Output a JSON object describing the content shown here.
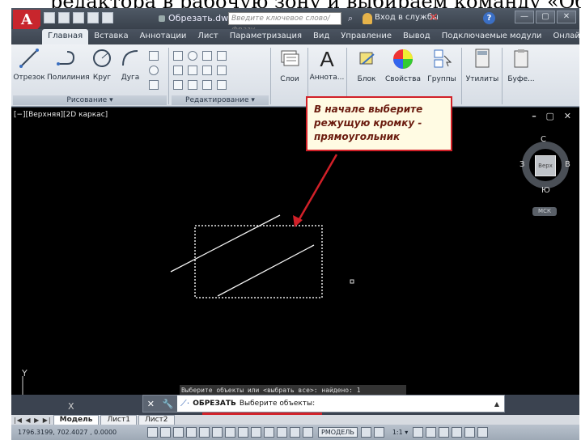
{
  "page_caption": "редактора в рабочую зону и выбираем команду «Обрезать» в группе",
  "title_bar": {
    "file_name": "Обрезать.dwg",
    "search_placeholder": "Введите ключевое слово/фразу",
    "signin": "Вход в службы",
    "window_buttons": [
      "—",
      "▢",
      "✕"
    ]
  },
  "ribbon_tabs": [
    "Главная",
    "Вставка",
    "Аннотации",
    "Лист",
    "Параметризация",
    "Вид",
    "Управление",
    "Вывод",
    "Подключаемые модули",
    "Онлайн",
    "»"
  ],
  "ribbon": {
    "draw": {
      "line": "Отрезок",
      "polyline": "Полилиния",
      "circle": "Круг",
      "arc": "Дуга",
      "group_label": "Рисование ▾"
    },
    "modify": {
      "group_label": "Редактирование ▾"
    },
    "layers": "Слои",
    "annotation": "Аннота...",
    "annotation_letter": "A",
    "block": "Блок",
    "properties": "Свойства",
    "groups": "Группы",
    "utilities": "Утилиты",
    "clipboard": "Буфе..."
  },
  "viewport": {
    "label": "[−][Верхняя][2D каркас]",
    "controls": "– ▢ ✕",
    "viewcube": {
      "top": "Верх",
      "n": "С",
      "s": "Ю",
      "w": "З",
      "e": "В",
      "wcs": "МСК"
    },
    "ucs": {
      "y": "Y",
      "x": "X"
    }
  },
  "callout": {
    "line1": "В начале выберите",
    "line2": "режущую кромку -",
    "line3": "прямоугольник",
    "border_color": "#d12028"
  },
  "command": {
    "history": "Выберите объекты или <выбрать все>: найдено: 1",
    "name": "ОБРЕЗАТЬ",
    "prompt": "Выберите объекты:",
    "dropdown": "▲"
  },
  "layout_tabs": {
    "nav": "|◀ ◀ ▶ ▶|",
    "tabs": [
      "Модель",
      "Лист1",
      "Лист2"
    ],
    "active": 0
  },
  "status_bar": {
    "coords": "1796.3199, 702.4027 , 0.0000",
    "model": "РМОДЕЛЬ",
    "scale": "1:1 ▾"
  }
}
